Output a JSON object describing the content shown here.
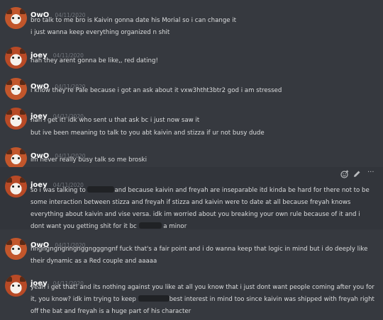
{
  "messages": [
    {
      "author": "OwO",
      "timestamp": "04/11/2020",
      "lines": [
        [
          "bro talk to me bro is Kaivin gonna date his Morial so i can change it"
        ],
        [
          "i just wanna keep everything organized n shit"
        ]
      ]
    },
    {
      "author": "joey",
      "timestamp": "04/11/2020",
      "lines": [
        [
          "nah they arent gonna be like,, red dating!"
        ]
      ]
    },
    {
      "author": "OwO",
      "timestamp": "04/11/2020",
      "lines": [
        [
          "i know they're Pale because i got an ask about it vxw3htht3btr2 god i am stressed"
        ]
      ]
    },
    {
      "author": "joey",
      "timestamp": "04/11/2020",
      "lines": [
        [
          "nah i get it! idk who sent u that ask bc i just now saw it"
        ],
        [
          "but ive been meaning to talk to you abt kaivin and stizza if ur not busy dude"
        ]
      ]
    },
    {
      "author": "OwO",
      "timestamp": "04/11/2020",
      "lines": [
        [
          "im never really busy talk so me broski"
        ]
      ]
    },
    {
      "author": "joey",
      "timestamp": "04/11/2020",
      "lines": [
        [
          "so i was talking to ",
          "and because kaivin and freyah are inseparable itd kinda be hard for there not to be"
        ],
        [
          "some interaction between stizza and freyah if stizza and kaivin were to date at all because freyah knows"
        ],
        [
          "everything about kaivin and vise versa. idk im worried about you breaking your own rule because of it and i"
        ],
        [
          "dont want you getting shit for it bc ",
          " a minor"
        ]
      ]
    },
    {
      "author": "OwO",
      "timestamp": "04/11/2020",
      "lines": [
        [
          "hngngngngnngnggngggngnf fuck that's a fair point and i do wanna keep that logic in mind but i do deeply like"
        ],
        [
          "their dynamic as a Red couple and aaaaa"
        ]
      ]
    },
    {
      "author": "joey",
      "timestamp": "04/11/2020",
      "lines": [
        [
          "yeah i get that! and its nothing against you like at all you know that i just dont want people coming after you for"
        ],
        [
          "it, you know? idk im trying to keep ",
          "best interest in mind too since kaivin was shipped with freyah right"
        ],
        [
          "off the bat and freyah is a huge part of his character"
        ]
      ]
    }
  ],
  "actions": {
    "reaction_icon": "add-reaction-icon",
    "edit_icon": "pencil-icon",
    "more_icon": "more-icon",
    "more_glyph": "···"
  }
}
